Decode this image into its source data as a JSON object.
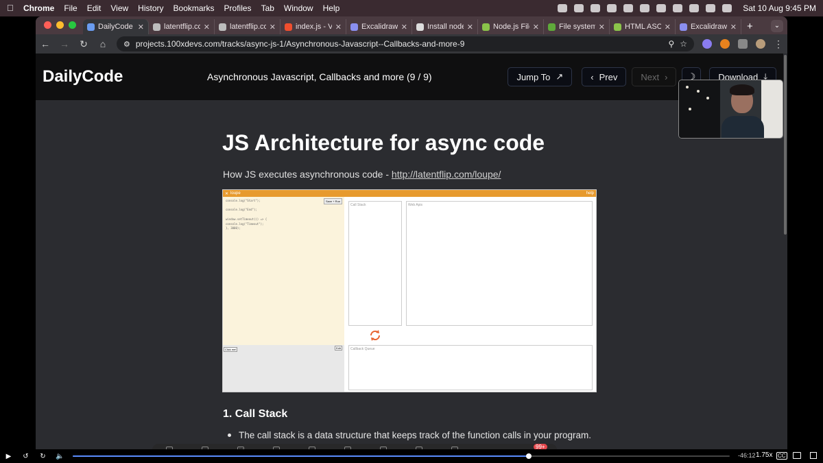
{
  "menubar": {
    "app": "Chrome",
    "items": [
      "File",
      "Edit",
      "View",
      "History",
      "Bookmarks",
      "Profiles",
      "Tab",
      "Window",
      "Help"
    ],
    "clock": "Sat 10 Aug  9:45 PM"
  },
  "tabs": [
    {
      "label": "DailyCode",
      "color": "#6a9cf0",
      "active": true
    },
    {
      "label": "latentflip.com/",
      "color": "#bdbdbd"
    },
    {
      "label": "latentflip.com/",
      "color": "#bdbdbd"
    },
    {
      "label": "index.js - Vigo",
      "color": "#f04e2e"
    },
    {
      "label": "Excalidraw",
      "color": "#8a8ff0"
    },
    {
      "label": "Install nodejs",
      "color": "#dddddd"
    },
    {
      "label": "Node.js File Sy",
      "color": "#8bc34a"
    },
    {
      "label": "File system | N",
      "color": "#5faa3a"
    },
    {
      "label": "HTML ASCII Re",
      "color": "#8bc34a"
    },
    {
      "label": "Excalidraw",
      "color": "#8a8ff0"
    }
  ],
  "address": {
    "url": "projects.100xdevs.com/tracks/async-js-1/Asynchronous-Javascript--Callbacks-and-more-9"
  },
  "site": {
    "brand": "DailyCode",
    "lesson": "Asynchronous Javascript, Callbacks and more (9 / 9)",
    "jump_to": "Jump To",
    "prev": "Prev",
    "next": "Next",
    "download": "Download"
  },
  "article": {
    "title": "JS Architecture for async code",
    "intro": "How JS executes asynchronous code - ",
    "link": "http://latentflip.com/loupe/",
    "section": "1. Call Stack",
    "bullet": "The call stack is a data structure that keeps track of the function calls in your program. It"
  },
  "loupe": {
    "name": "loupe",
    "help": "help",
    "save_run": "Save + Run",
    "code": [
      "console.log(\"Start\");",
      "",
      "console.log(\"End\");",
      "",
      "window.setTimeout(() => {",
      "   console.log(\"Timeout\");",
      "}, 3000);",
      "",
      ""
    ],
    "click_me": "Click me!",
    "edit": "Edit",
    "call_stack": "Call Stack",
    "web_apis": "Web Apis",
    "callback_queue": "Callback Queue"
  },
  "player": {
    "progress_percent": 69.4,
    "time": "-46:12",
    "speed": "1.75x",
    "cc": "CC",
    "badge": "99+"
  },
  "colors": {
    "accent": "#e79a2e",
    "link": "#d0d0d0"
  }
}
